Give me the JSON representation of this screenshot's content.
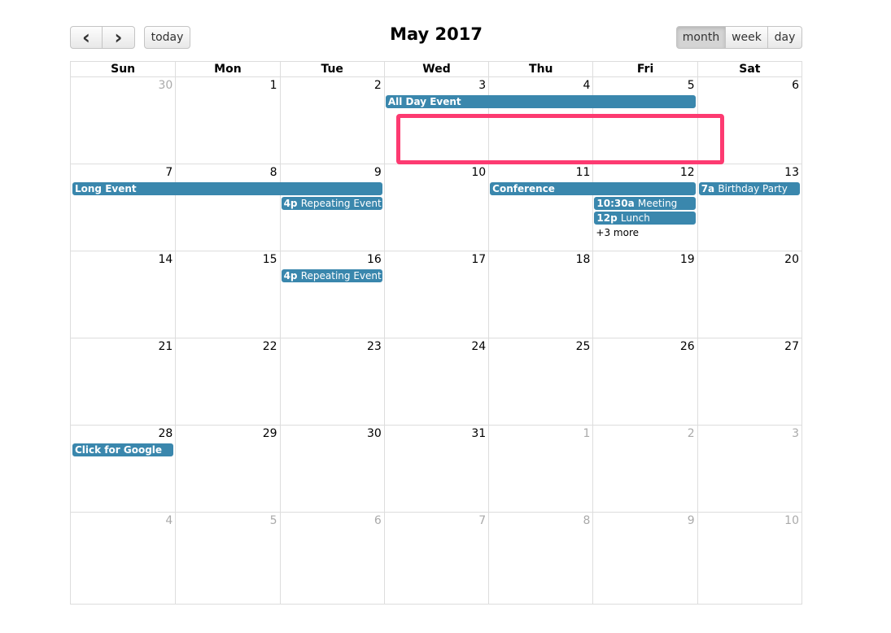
{
  "header": {
    "title": "May 2017",
    "prev_icon": "chevron-left-icon",
    "next_icon": "chevron-right-icon",
    "prev_glyph": "‹",
    "next_glyph": "›",
    "today_label": "today",
    "views": [
      {
        "label": "month",
        "active": true
      },
      {
        "label": "week",
        "active": false
      },
      {
        "label": "day",
        "active": false
      }
    ]
  },
  "weekdays": [
    "Sun",
    "Mon",
    "Tue",
    "Wed",
    "Thu",
    "Fri",
    "Sat"
  ],
  "weeks": [
    {
      "days": [
        {
          "n": "30",
          "other": true
        },
        {
          "n": "1"
        },
        {
          "n": "2"
        },
        {
          "n": "3"
        },
        {
          "n": "4"
        },
        {
          "n": "5"
        },
        {
          "n": "6"
        }
      ]
    },
    {
      "days": [
        {
          "n": "7"
        },
        {
          "n": "8"
        },
        {
          "n": "9"
        },
        {
          "n": "10"
        },
        {
          "n": "11"
        },
        {
          "n": "12"
        },
        {
          "n": "13"
        }
      ]
    },
    {
      "days": [
        {
          "n": "14"
        },
        {
          "n": "15"
        },
        {
          "n": "16"
        },
        {
          "n": "17"
        },
        {
          "n": "18"
        },
        {
          "n": "19"
        },
        {
          "n": "20"
        }
      ]
    },
    {
      "days": [
        {
          "n": "21"
        },
        {
          "n": "22"
        },
        {
          "n": "23"
        },
        {
          "n": "24"
        },
        {
          "n": "25"
        },
        {
          "n": "26"
        },
        {
          "n": "27"
        }
      ]
    },
    {
      "days": [
        {
          "n": "28"
        },
        {
          "n": "29"
        },
        {
          "n": "30"
        },
        {
          "n": "31"
        },
        {
          "n": "1",
          "other": true
        },
        {
          "n": "2",
          "other": true
        },
        {
          "n": "3",
          "other": true
        }
      ]
    },
    {
      "days": [
        {
          "n": "4",
          "other": true
        },
        {
          "n": "5",
          "other": true
        },
        {
          "n": "6",
          "other": true
        },
        {
          "n": "7",
          "other": true
        },
        {
          "n": "8",
          "other": true
        },
        {
          "n": "9",
          "other": true
        },
        {
          "n": "10",
          "other": true
        }
      ]
    }
  ],
  "events": [
    {
      "week": 0,
      "start": 3,
      "span": 3,
      "row": 0,
      "time": "",
      "title": "All Day Event"
    },
    {
      "week": 1,
      "start": 0,
      "span": 3,
      "row": 0,
      "time": "",
      "title": "Long Event"
    },
    {
      "week": 1,
      "start": 2,
      "span": 1,
      "row": 1,
      "time": "4p",
      "title": "Repeating Event"
    },
    {
      "week": 1,
      "start": 4,
      "span": 2,
      "row": 0,
      "time": "",
      "title": "Conference"
    },
    {
      "week": 1,
      "start": 5,
      "span": 1,
      "row": 1,
      "time": "10:30a",
      "title": "Meeting"
    },
    {
      "week": 1,
      "start": 5,
      "span": 1,
      "row": 2,
      "time": "12p",
      "title": "Lunch"
    },
    {
      "week": 1,
      "start": 6,
      "span": 1,
      "row": 0,
      "time": "7a",
      "title": "Birthday Party"
    },
    {
      "week": 2,
      "start": 2,
      "span": 1,
      "row": 0,
      "time": "4p",
      "title": "Repeating Event"
    },
    {
      "week": 4,
      "start": 0,
      "span": 1,
      "row": 0,
      "time": "",
      "title": "Click for Google"
    }
  ],
  "more_links": [
    {
      "week": 1,
      "day": 5,
      "row": 3,
      "label": "+3 more"
    }
  ],
  "colors": {
    "event": "#3a87ad",
    "highlight": "#fd3a71",
    "other_month_text": "#aaaaaa",
    "grid_line": "#dddddd"
  }
}
